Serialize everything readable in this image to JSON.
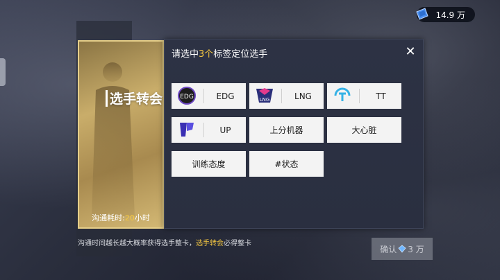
{
  "currency": {
    "amount": "14.9 万",
    "icon": "ticket-icon"
  },
  "dialog": {
    "title_prefix": "请选中",
    "title_count": "3个",
    "title_suffix": "标签定位选手",
    "close_label": "✕"
  },
  "tags": [
    {
      "label": "EDG",
      "logo": "edg-logo"
    },
    {
      "label": "LNG",
      "logo": "lng-logo"
    },
    {
      "label": "TT",
      "logo": "tt-logo"
    },
    {
      "label": "UP",
      "logo": "up-logo"
    },
    {
      "label": "上分机器"
    },
    {
      "label": "大心脏"
    },
    {
      "label": "训练态度"
    },
    {
      "label": "#状态"
    }
  ],
  "card": {
    "title": "选手转会",
    "time_prefix": "沟通耗时:",
    "time_value": "20",
    "time_unit": "小时"
  },
  "note": {
    "text_a": "沟通时间越长越大概率获得选手整卡，",
    "highlight": "选手转会",
    "text_b": "必得整卡"
  },
  "confirm": {
    "label": "确认",
    "cost": "3 万",
    "icon": "diamond-icon"
  },
  "colors": {
    "accent": "#f5c842",
    "card_gold": "#c9ad6a",
    "dialog_bg": "#2d3244"
  }
}
